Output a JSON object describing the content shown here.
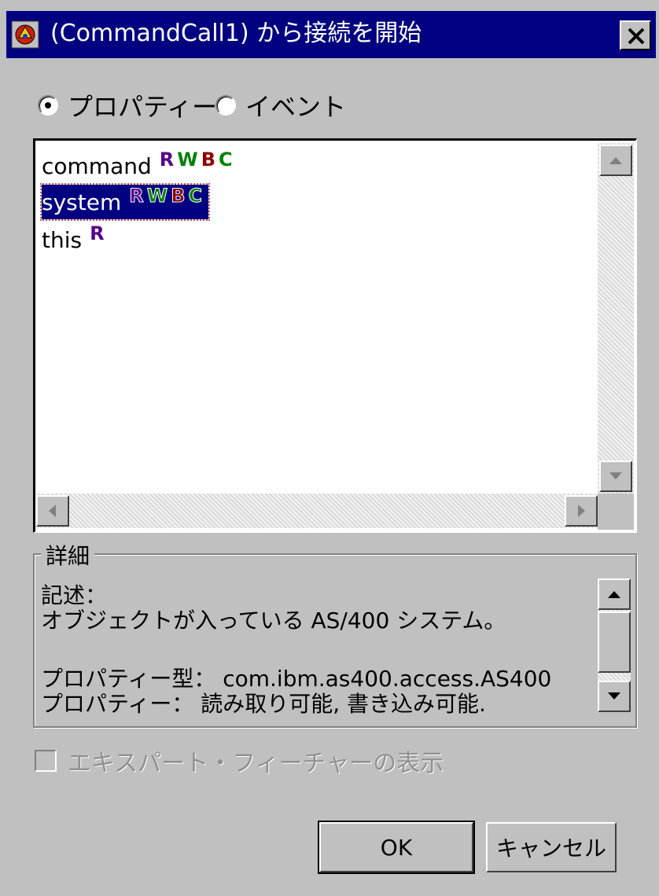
{
  "window": {
    "title": "(CommandCall1) から接続を開始",
    "close_glyph": "✕"
  },
  "tabs": {
    "properties_label": "プロパティー",
    "events_label": "イベント",
    "selected": "properties"
  },
  "properties_list": {
    "items": [
      {
        "name": "command",
        "badges": [
          "R",
          "W",
          "B",
          "C"
        ]
      },
      {
        "name": "system",
        "badges": [
          "R",
          "W",
          "B",
          "C"
        ],
        "selected": true
      },
      {
        "name": "this",
        "badges": [
          "R"
        ]
      }
    ]
  },
  "details": {
    "group_label": "詳細",
    "description_label": "記述：",
    "description": "オブジェクトが入っている AS/400 システム。",
    "type_line": "プロパティー型： com.ibm.as400.access.AS400",
    "access_line": "プロパティー： 読み取り可能, 書き込み可能."
  },
  "expert_features": {
    "label": "エキスパート・フィーチャーの表示",
    "checked": false,
    "enabled": false
  },
  "buttons": {
    "ok": "OK",
    "cancel": "キャンセル"
  },
  "colors": {
    "titlebar": "#000080",
    "face": "#c0c0c0",
    "selection": "#000080",
    "badge_r": "#55008a",
    "badge_w": "#008000",
    "badge_b": "#8b0000"
  }
}
